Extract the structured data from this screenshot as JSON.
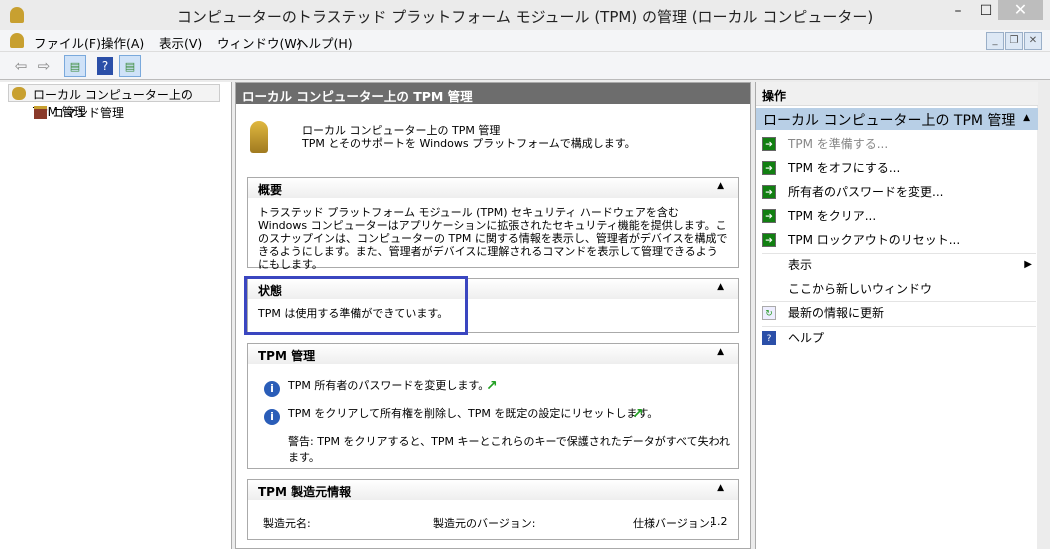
{
  "window": {
    "title": "コンピューターのトラステッド プラットフォーム モジュール (TPM) の管理 (ローカル コンピューター)",
    "minimize": "–",
    "maximize": "☐",
    "close": "✕"
  },
  "menu": [
    "ファイル(F)",
    "操作(A)",
    "表示(V)",
    "ウィンドウ(W)",
    "ヘルプ(H)"
  ],
  "tree": {
    "root": "ローカル コンピューター上の TPM 管理",
    "child": "コマンド管理"
  },
  "main": {
    "header": "ローカル コンピューター上の TPM 管理",
    "intro": [
      "ローカル コンピューター上の TPM 管理",
      "TPM とそのサポートを Windows プラットフォームで構成します。"
    ],
    "overview": {
      "title": "概要",
      "text": "トラステッド プラットフォーム モジュール (TPM) セキュリティ ハードウェアを含む Windows コンピューターはアプリケーションに拡張されたセキュリティ機能を提供します。このスナップインは、コンピューターの TPM に関する情報を表示し、管理者がデバイスを構成できるようにします。また、管理者がデバイスに理解されるコマンドを表示して管理できるようにもします。"
    },
    "status": {
      "title": "状態",
      "text": "TPM は使用する準備ができています。"
    },
    "management": {
      "title": "TPM 管理",
      "items": [
        "TPM 所有者のパスワードを変更します。",
        "TPM をクリアして所有権を削除し、TPM を既定の設定にリセットします。"
      ],
      "warning": "警告: TPM をクリアすると、TPM キーとこれらのキーで保護されたデータがすべて失われます。"
    },
    "manufacturer": {
      "title": "TPM 製造元情報",
      "name_label": "製造元名:",
      "version_label": "製造元のバージョン:",
      "spec_label": "仕様バージョン:",
      "spec_value": "1.2"
    }
  },
  "actions": {
    "header": "操作",
    "group": "ローカル コンピューター上の TPM 管理",
    "items": [
      "TPM を準備する...",
      "TPM をオフにする...",
      "所有者のパスワードを変更...",
      "TPM をクリア...",
      "TPM ロックアウトのリセット..."
    ],
    "view": "表示",
    "new_window": "ここから新しいウィンドウ",
    "refresh": "最新の情報に更新",
    "help": "ヘルプ"
  }
}
